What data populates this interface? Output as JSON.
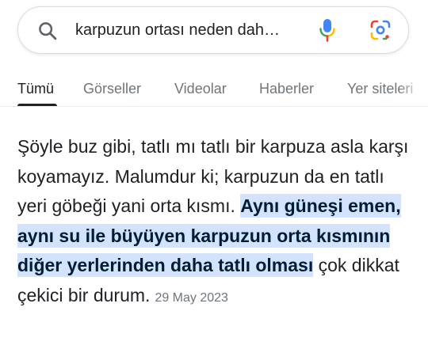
{
  "search": {
    "query": "karpuzun ortası neden dah…",
    "icons": {
      "search": "search-icon",
      "voice": "mic-icon",
      "lens": "google-lens-icon"
    }
  },
  "tabs": [
    {
      "label": "Tümü",
      "active": true
    },
    {
      "label": "Görseller",
      "active": false
    },
    {
      "label": "Videolar",
      "active": false
    },
    {
      "label": "Haberler",
      "active": false
    },
    {
      "label": "Yer siteleri",
      "active": false
    }
  ],
  "snippet": {
    "text_before": "Şöyle buz gibi, tatlı mı tatlı bir karpuza asla karşı koyamayız. Malumdur ki; karpuzun da en tatlı yeri göbeği yani orta kısmı. ",
    "highlight": "Aynı güneşi emen, aynı su ile büyüyen karpuzun orta kısmının diğer yerlerinden daha tatlı olması",
    "text_after": " çok dikkat çekici bir durum.",
    "date": "29 May 2023"
  },
  "colors": {
    "highlight_bg": "#d3e3fd",
    "active_tab": "#202124",
    "inactive_tab": "#70757a",
    "mic_blue": "#4285f4",
    "mic_red": "#ea4335"
  }
}
